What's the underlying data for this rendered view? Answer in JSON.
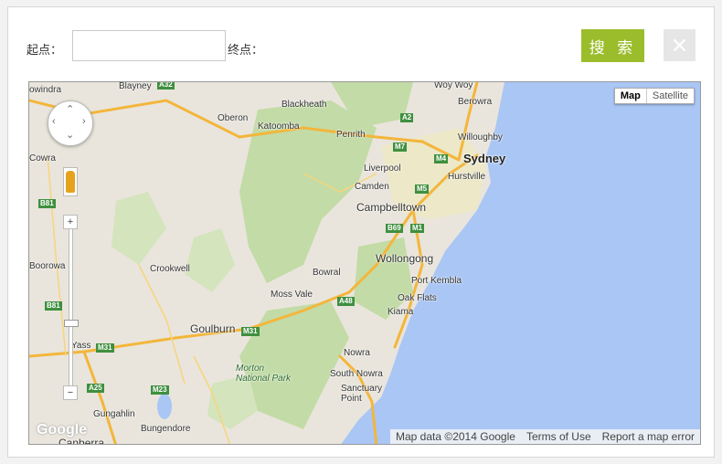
{
  "form": {
    "start_label": "起点：",
    "end_label": "终点：",
    "search_label": "搜 索",
    "close_glyph": "×",
    "start_value": ""
  },
  "map": {
    "map_type": {
      "map": "Map",
      "satellite": "Satellite",
      "selected": "Map"
    },
    "attribution": {
      "data": "Map data ©2014 Google",
      "terms": "Terms of Use",
      "report": "Report a map error"
    },
    "logo": "Google",
    "labels": {
      "sydney": "Sydney",
      "wollongong": "Wollongong",
      "campbelltown": "Campbelltown",
      "liverpool": "Liverpool",
      "camden": "Camden",
      "penrith": "Penrith",
      "katoomba": "Katoomba",
      "blackheath": "Blackheath",
      "oberon": "Oberon",
      "blayney": "Blayney",
      "cowra": "Cowra",
      "bowindra": "owindra",
      "boorowa": "Boorowa",
      "crookwell": "Crookwell",
      "goulburn": "Goulburn",
      "moss_vale": "Moss Vale",
      "bowral": "Bowral",
      "port_kembla": "Port Kembla",
      "oak_flats": "Oak Flats",
      "kiama": "Kiama",
      "nowra": "Nowra",
      "south_nowra": "South Nowra",
      "sanctuary_point": "Sanctuary Point",
      "morton": "Morton National Park",
      "yass": "Yass",
      "gungahlin": "Gungahlin",
      "bungendore": "Bungendore",
      "canberra": "Canberra",
      "willoughby": "Willoughby",
      "hurstville": "Hurstville",
      "berowra": "Berowra",
      "woy_woy": "Woy Woy"
    },
    "shields": {
      "a2": "A2",
      "m7": "M7",
      "m4": "M4",
      "m5": "M5",
      "b69": "B69",
      "m1": "M1",
      "a48": "A48",
      "m31a": "M31",
      "m31b": "M31",
      "a25": "A25",
      "m23": "M23",
      "b81a": "B81",
      "b81b": "B81",
      "a32": "A32"
    },
    "colors": {
      "ocean": "#a9c6f5",
      "land": "#e9e5dc",
      "park": "#c3dba7",
      "road": "#f3b63b"
    }
  }
}
